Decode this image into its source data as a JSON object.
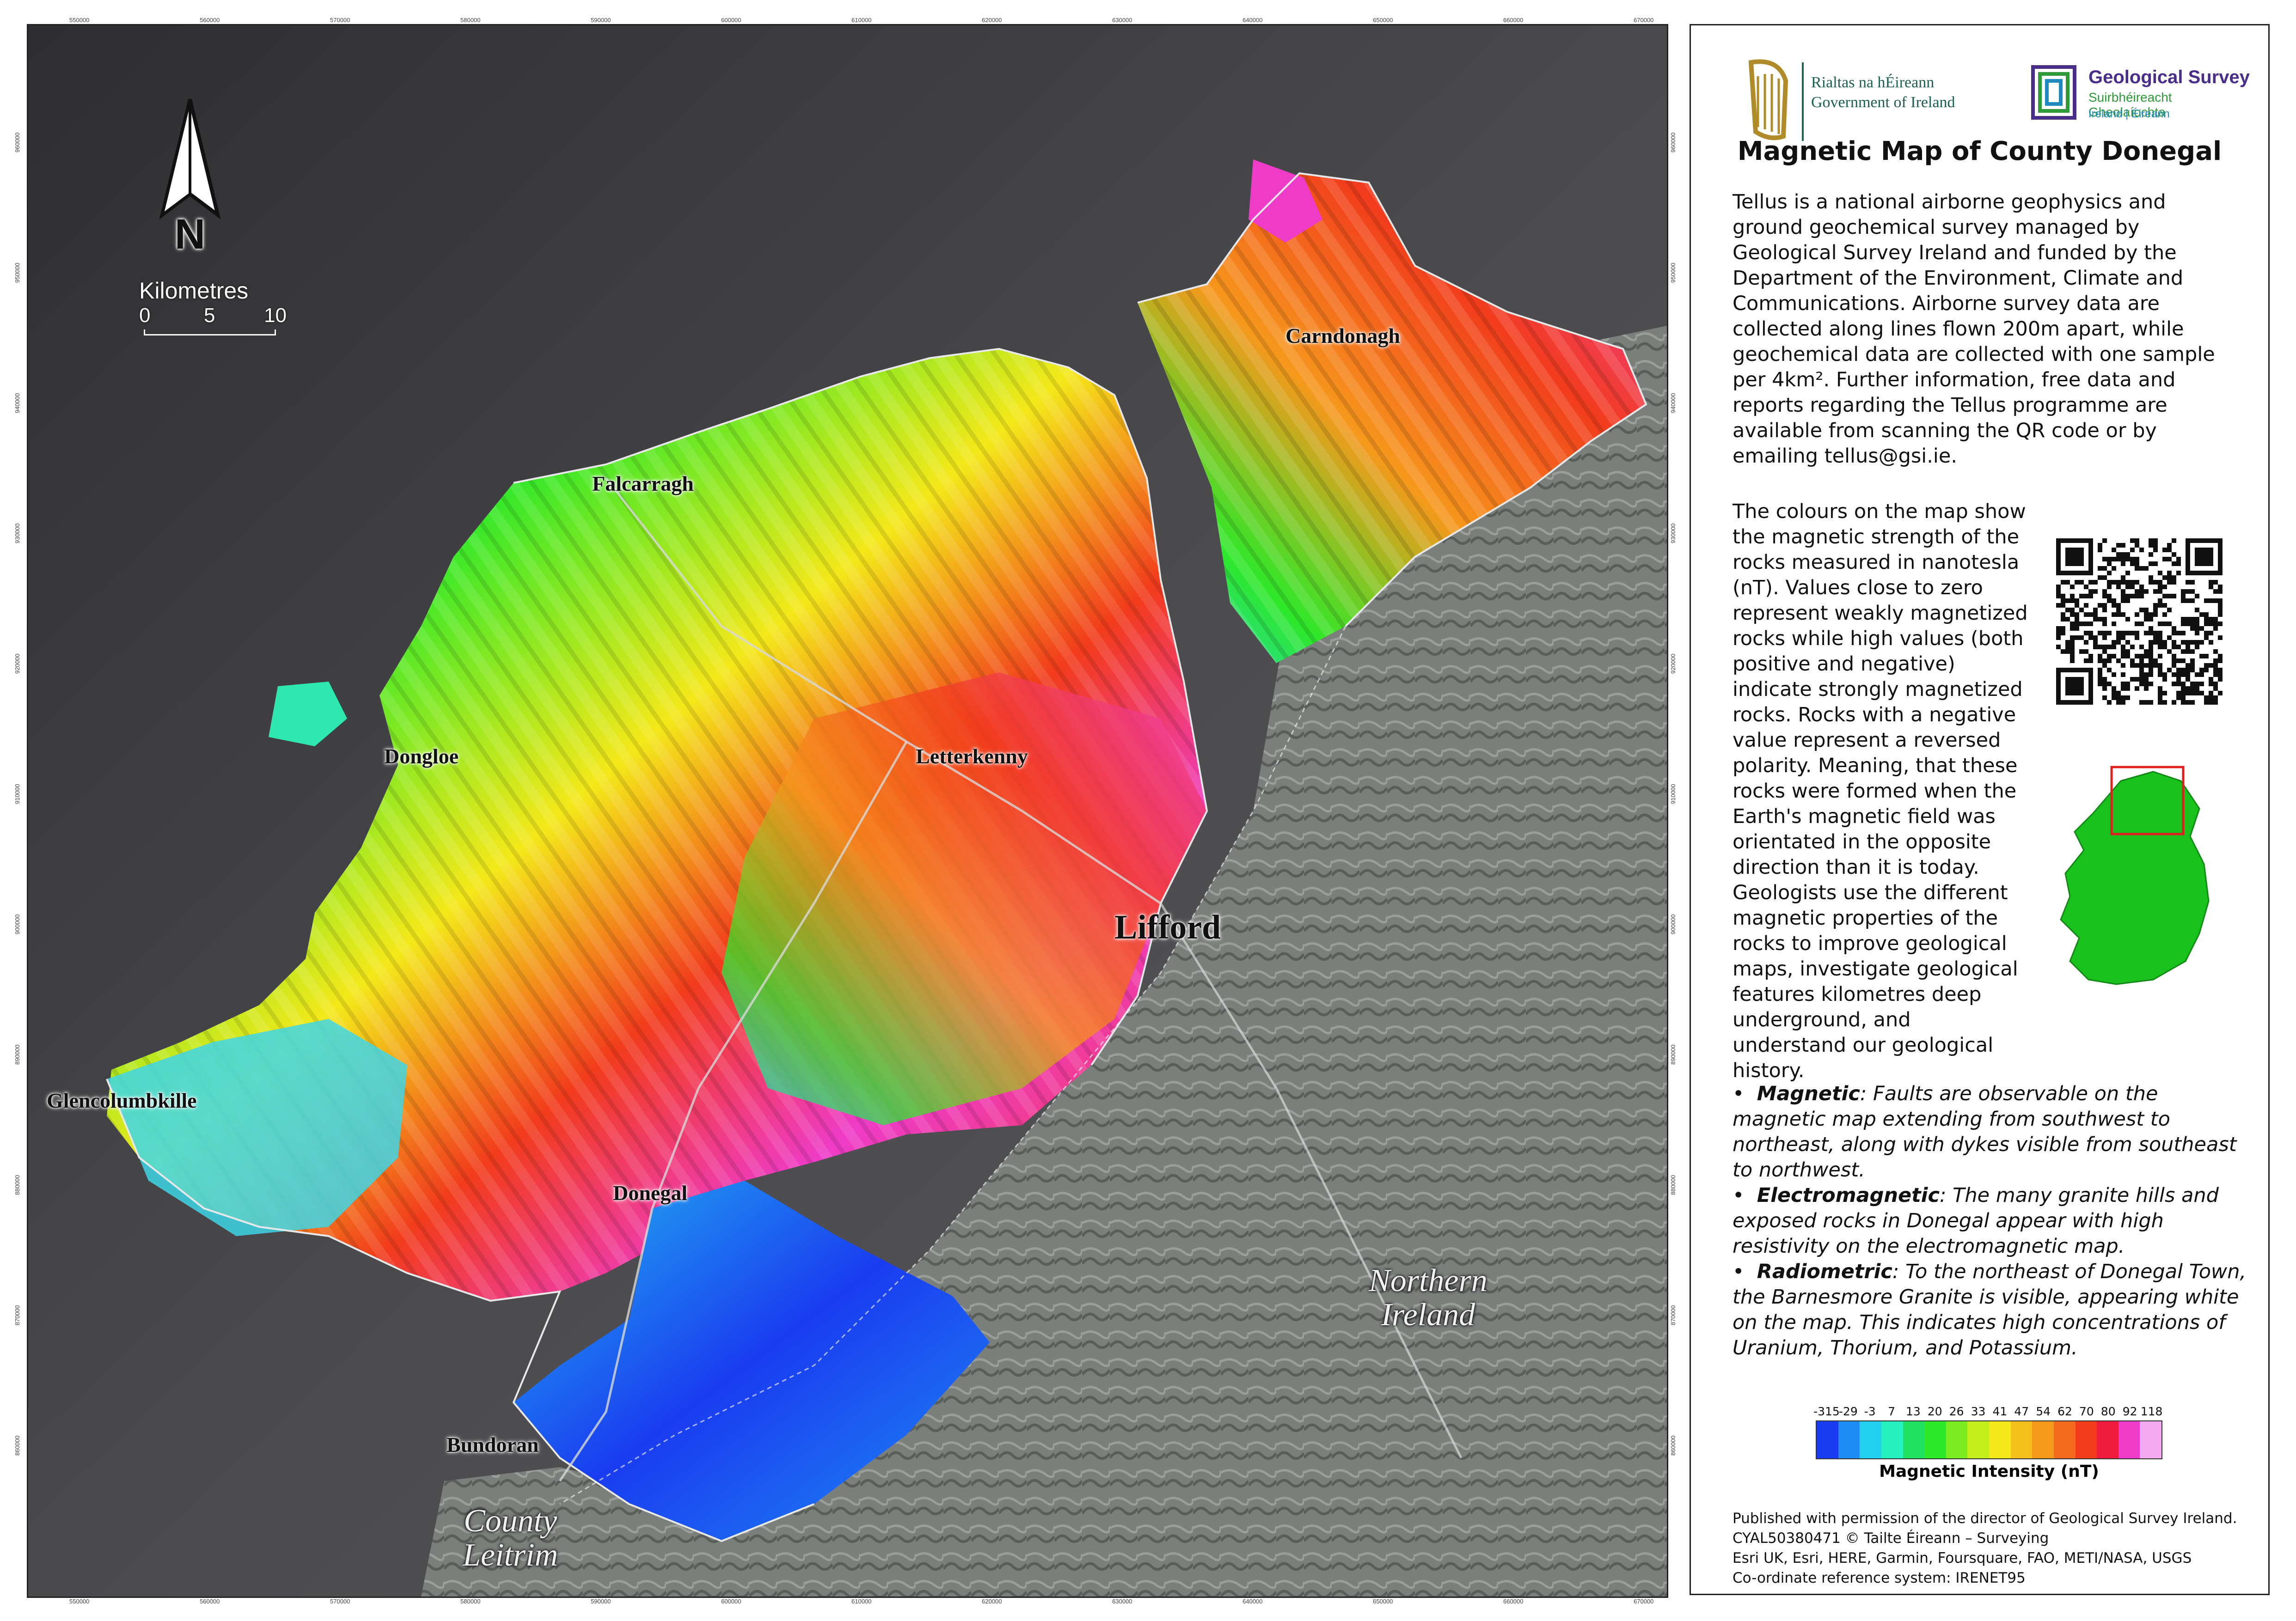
{
  "map": {
    "x_ticks": [
      "550000",
      "560000",
      "570000",
      "580000",
      "590000",
      "600000",
      "610000",
      "620000",
      "630000",
      "640000",
      "650000",
      "660000",
      "670000"
    ],
    "y_ticks": [
      "960000",
      "950000",
      "940000",
      "930000",
      "920000",
      "910000",
      "900000",
      "890000",
      "880000",
      "870000",
      "860000"
    ],
    "north_label": "N",
    "scale": {
      "title": "Kilometres",
      "labels": [
        "0",
        "5",
        "10"
      ]
    },
    "places": {
      "carndonagh": "Carndonagh",
      "falcarragh": "Falcarragh",
      "dongloe": "Dongloe",
      "letterkenny": "Letterkenny",
      "lifford": "Lifford",
      "glencolumbkille": "Glencolumbkille",
      "donegal": "Donegal",
      "bundoran": "Bundoran"
    },
    "regions": {
      "northern_ireland": "Northern\nIreland",
      "county_leitrim": "County\nLeitrim"
    },
    "colors": {
      "sea": "#3a3a3c",
      "land": "#7d817e"
    }
  },
  "panel": {
    "gov_logo": {
      "line1": "Rialtas na hÉireann",
      "line2": "Government of Ireland"
    },
    "gsi_logo": {
      "line1": "Geological Survey",
      "line2": "Suirbhéireacht Gheolaíochta",
      "line3": "Ireland | Éireann"
    },
    "title": "Magnetic Map of County Donegal",
    "intro": "Tellus is a national airborne geophysics and ground geochemical survey managed by Geological Survey Ireland and funded by the Department of the Environment, Climate and Communications. Airborne survey data are collected along lines flown 200m apart, while geochemical data are collected with one sample per 4km². Further information, free data and reports regarding the Tellus programme are available from scanning the QR code or by emailing tellus@gsi.ie.",
    "colours": "The colours on the map show the magnetic strength of the rocks measured in nanotesla (nT). Values close to zero represent weakly magnetized rocks while high values (both positive and negative) indicate strongly magnetized rocks. Rocks with a negative value represent a reversed polarity. Meaning, that these rocks were formed when the Earth's magnetic field was orientated in the opposite direction than it is today. Geologists use the different magnetic properties of the rocks to improve geological maps, investigate geological features kilometres deep underground, and understand our geological history.",
    "bullets": [
      {
        "label": "Magnetic",
        "text": ": Faults are observable on the magnetic map extending from southwest to northeast, along with dykes visible from southeast to northwest."
      },
      {
        "label": "Electromagnetic",
        "text": ": The many granite hills and exposed rocks in Donegal appear with high resistivity on the electromagnetic map."
      },
      {
        "label": "Radiometric",
        "text": ": To the northeast of Donegal Town, the Barnesmore Granite is visible, appearing white on the map. This indicates high concentrations of Uranium, Thorium, and Potassium."
      }
    ],
    "legend": {
      "values": [
        "-315",
        "-29",
        "-3",
        "7",
        "13",
        "20",
        "26",
        "33",
        "41",
        "47",
        "54",
        "62",
        "70",
        "80",
        "92",
        "118"
      ],
      "colors": [
        "#1a3cf0",
        "#1e8cf5",
        "#22d0f0",
        "#25f0c0",
        "#20e060",
        "#2ee82a",
        "#7aec20",
        "#c4ee1a",
        "#f4e81a",
        "#f6c01c",
        "#f6981c",
        "#f46a1c",
        "#f23c1c",
        "#f01a3c",
        "#ee3cc8",
        "#f4aaf0"
      ],
      "title": "Magnetic Intensity (nT)"
    },
    "credits": [
      "Published with permission of the director of Geological Survey Ireland.",
      "CYAL50380471 © Tailte Éireann – Surveying",
      "Esri UK, Esri, HERE, Garmin, Foursquare, FAO, METI/NASA, USGS",
      "Co-ordinate reference system: IRENET95"
    ]
  }
}
